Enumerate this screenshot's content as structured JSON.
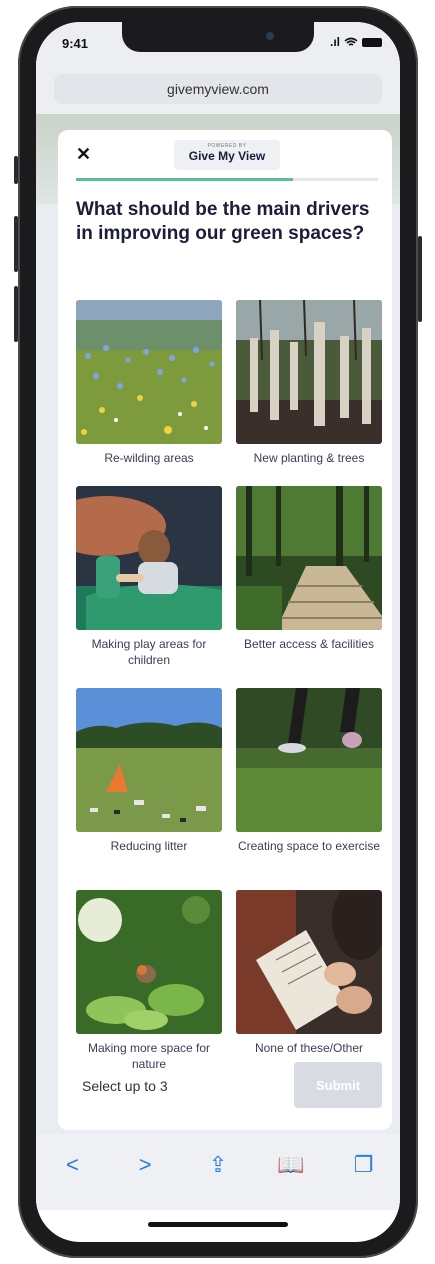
{
  "status": {
    "time": "9:41",
    "signal": ".ıl"
  },
  "browser": {
    "url": "givemyview.com"
  },
  "header": {
    "close_glyph": "✕",
    "powered_by": "POWERED BY",
    "brand": "Give My View"
  },
  "progress": {
    "fraction": 0.72
  },
  "question": "What should be the main drivers in improving our green spaces?",
  "options": [
    {
      "label": "Re-wilding areas"
    },
    {
      "label": "New planting & trees"
    },
    {
      "label": "Making play areas for children"
    },
    {
      "label": "Better access & facilities"
    },
    {
      "label": "Reducing litter"
    },
    {
      "label": "Creating space to exercise"
    },
    {
      "label": "Making more space for nature"
    },
    {
      "label": "None of these/Other"
    }
  ],
  "footer": {
    "hint": "Select up to 3",
    "submit_label": "Submit"
  },
  "toolbar": {
    "back": "<",
    "forward": ">",
    "share": "⇪",
    "bookmarks": "📖",
    "tabs": "❐"
  }
}
